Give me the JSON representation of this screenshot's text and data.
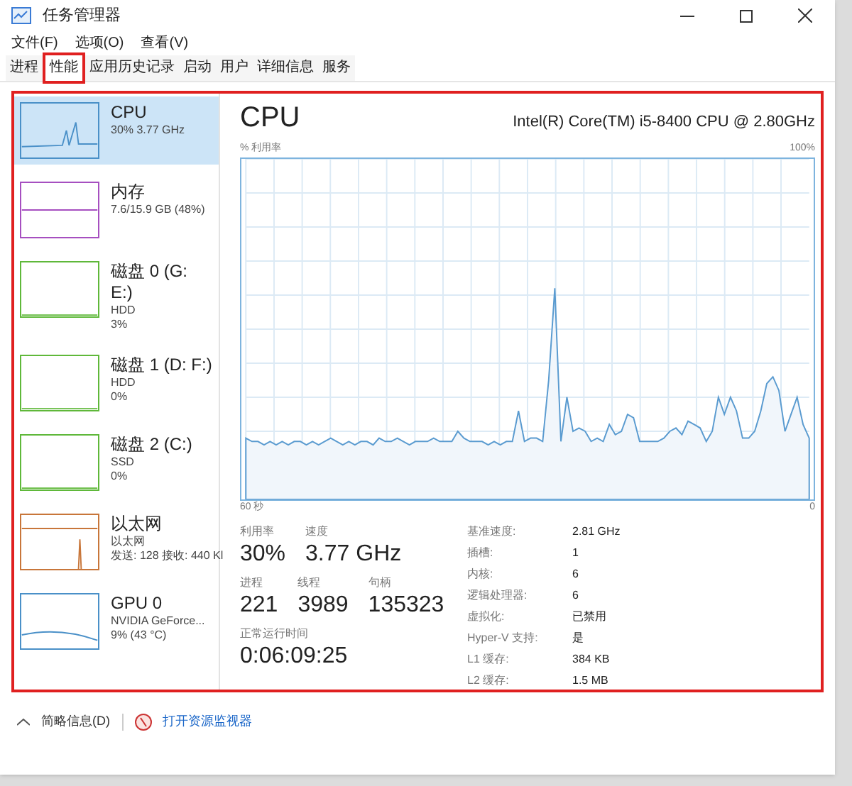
{
  "window": {
    "title": "任务管理器"
  },
  "menu": [
    "文件(F)",
    "选项(O)",
    "查看(V)"
  ],
  "tabs": [
    {
      "label": "进程",
      "selected": false
    },
    {
      "label": "性能",
      "selected": true
    },
    {
      "label": "应用历史记录",
      "selected": false
    },
    {
      "label": "启动",
      "selected": false
    },
    {
      "label": "用户",
      "selected": false
    },
    {
      "label": "详细信息",
      "selected": false
    },
    {
      "label": "服务",
      "selected": false
    }
  ],
  "sidebar": {
    "items": [
      {
        "name": "CPU",
        "lines": [
          "30% 3.77 GHz"
        ],
        "color": "#4a90c8",
        "selected": true
      },
      {
        "name": "内存",
        "lines": [
          "7.6/15.9 GB (48%)"
        ],
        "color": "#a64fc0",
        "selected": false
      },
      {
        "name": "磁盘 0 (G: E:)",
        "lines": [
          "HDD",
          "3%"
        ],
        "color": "#5fb83a",
        "selected": false
      },
      {
        "name": "磁盘 1 (D: F:)",
        "lines": [
          "HDD",
          "0%"
        ],
        "color": "#5fb83a",
        "selected": false
      },
      {
        "name": "磁盘 2 (C:)",
        "lines": [
          "SSD",
          "0%"
        ],
        "color": "#5fb83a",
        "selected": false
      },
      {
        "name": "以太网",
        "lines": [
          "以太网",
          "发送: 128 接收: 440 Kl"
        ],
        "color": "#c8763a",
        "selected": false
      },
      {
        "name": "GPU 0",
        "lines": [
          "NVIDIA GeForce...",
          "9% (43 °C)"
        ],
        "color": "#4a90c8",
        "selected": false
      }
    ]
  },
  "main": {
    "title": "CPU",
    "model": "Intel(R) Core(TM) i5-8400 CPU @ 2.80GHz",
    "graph_label": "% 利用率",
    "graph_max": "100%",
    "graph_time": "60 秒",
    "graph_min": "0",
    "stats": [
      [
        {
          "label": "利用率",
          "value": "30%"
        },
        {
          "label": "速度",
          "value": "3.77 GHz"
        }
      ],
      [
        {
          "label": "进程",
          "value": "221"
        },
        {
          "label": "线程",
          "value": "3989"
        },
        {
          "label": "句柄",
          "value": "135323"
        }
      ],
      [
        {
          "label": "正常运行时间",
          "value": "0:06:09:25"
        }
      ]
    ],
    "details": [
      [
        "基准速度:",
        "2.81 GHz"
      ],
      [
        "插槽:",
        "1"
      ],
      [
        "内核:",
        "6"
      ],
      [
        "逻辑处理器:",
        "6"
      ],
      [
        "虚拟化:",
        "已禁用"
      ],
      [
        "Hyper-V 支持:",
        "是"
      ],
      [
        "L1 缓存:",
        "384 KB"
      ],
      [
        "L2 缓存:",
        "1.5 MB"
      ]
    ]
  },
  "footer": {
    "summary": "简略信息(D)",
    "monitor_link": "打开资源监视器"
  }
}
